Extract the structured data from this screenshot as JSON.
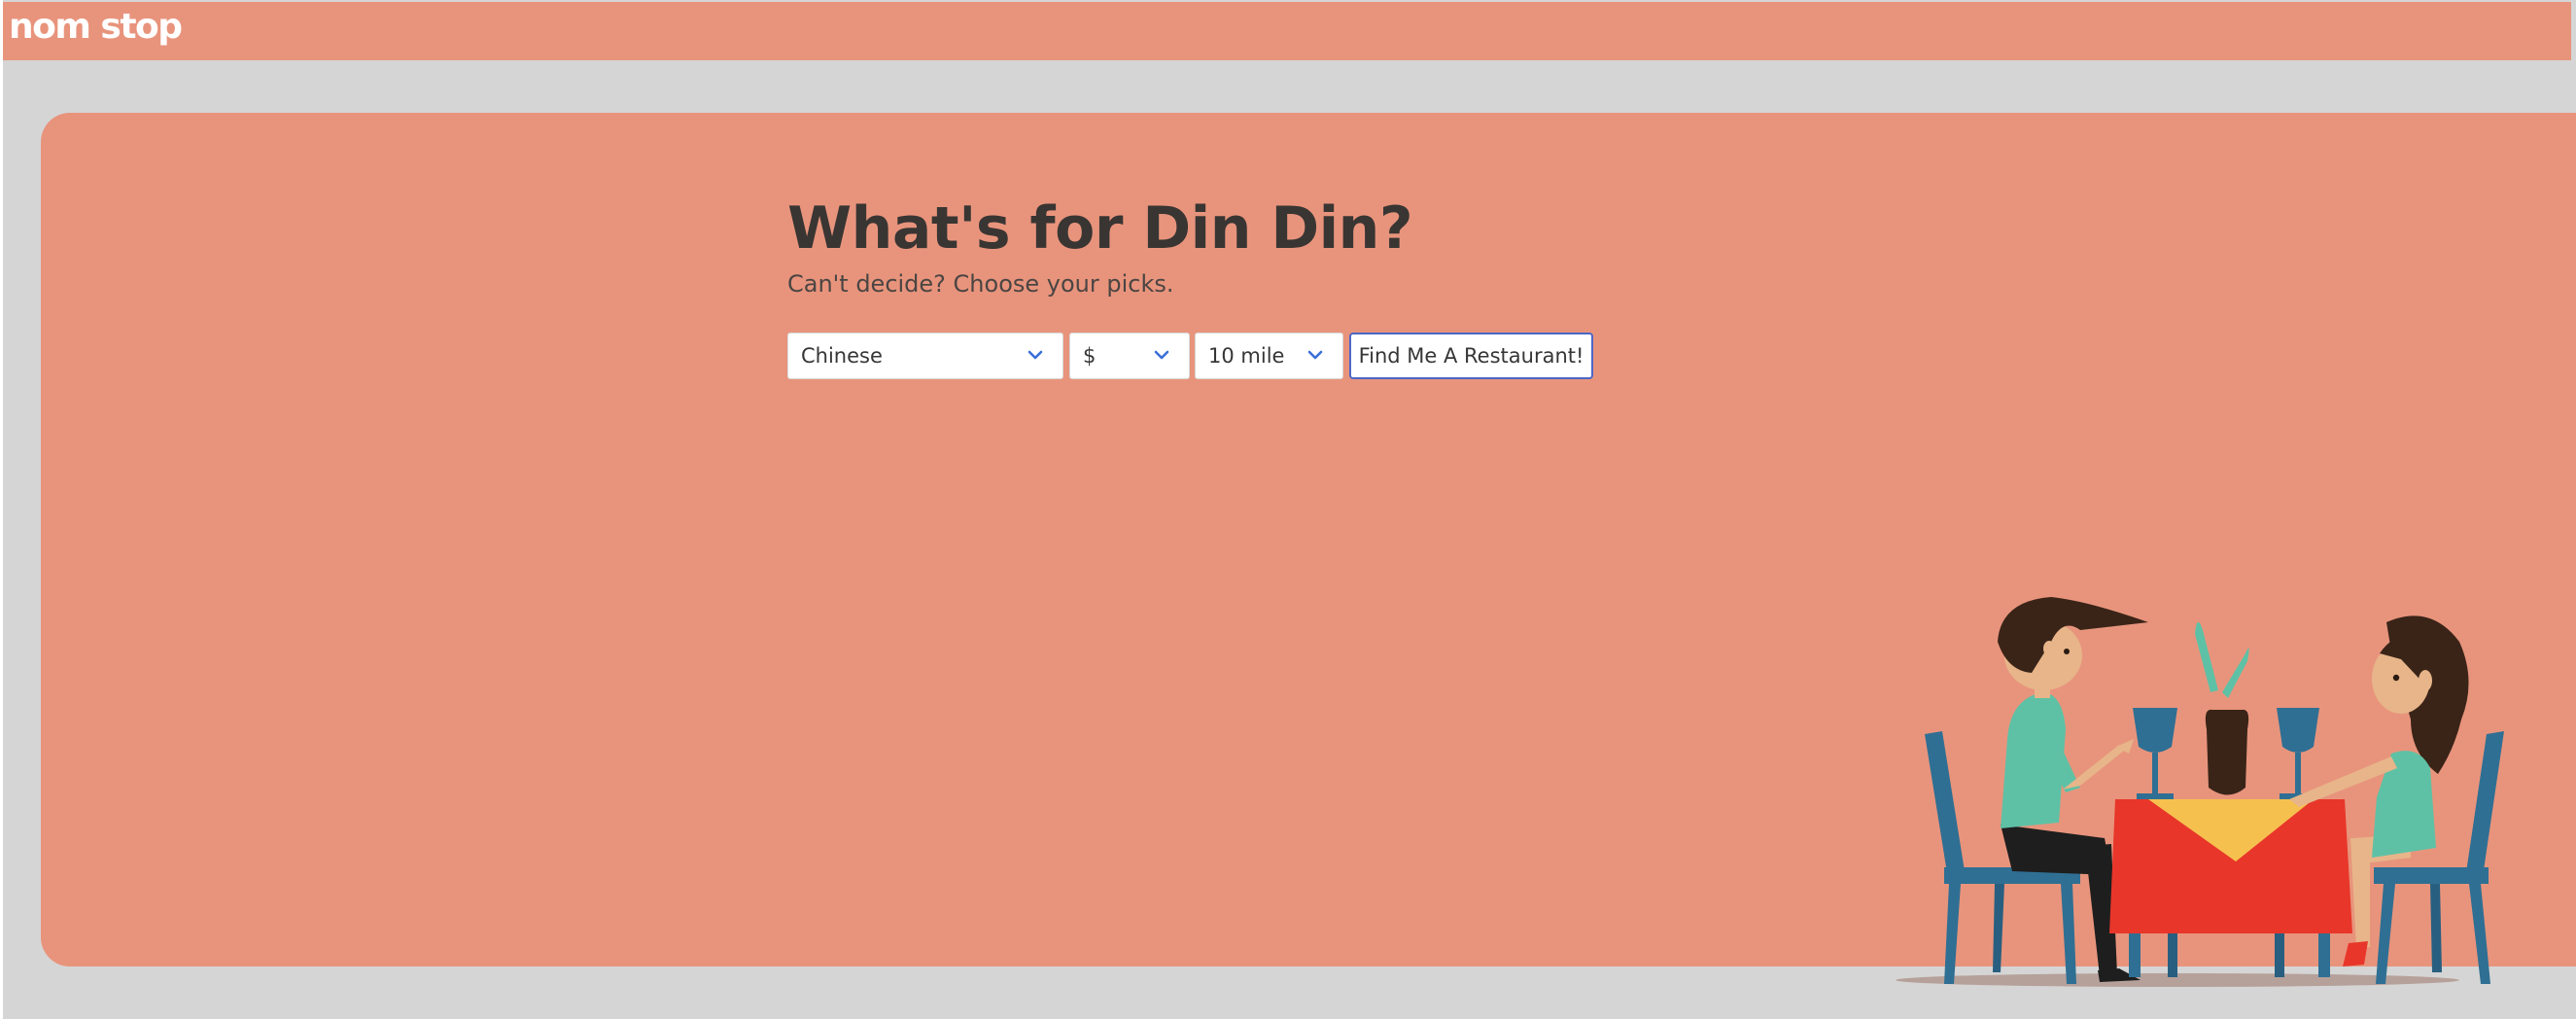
{
  "header": {
    "logo_text": "nom stop"
  },
  "hero": {
    "title": "What's for Din Din?",
    "subtitle": "Can't decide? Choose your picks."
  },
  "filters": {
    "cuisine": {
      "value": "Chinese",
      "icon": "chevron-down-icon"
    },
    "price": {
      "value": "$",
      "icon": "chevron-down-icon"
    },
    "distance": {
      "value": "10 mile",
      "icon": "chevron-down-icon"
    }
  },
  "actions": {
    "find_label": "Find Me A Restaurant!"
  },
  "colors": {
    "brand": "#e8947c",
    "background": "#d5d5d5",
    "text": "#393533",
    "chevron": "#3b6fd8",
    "button_border": "#4d67c8"
  }
}
